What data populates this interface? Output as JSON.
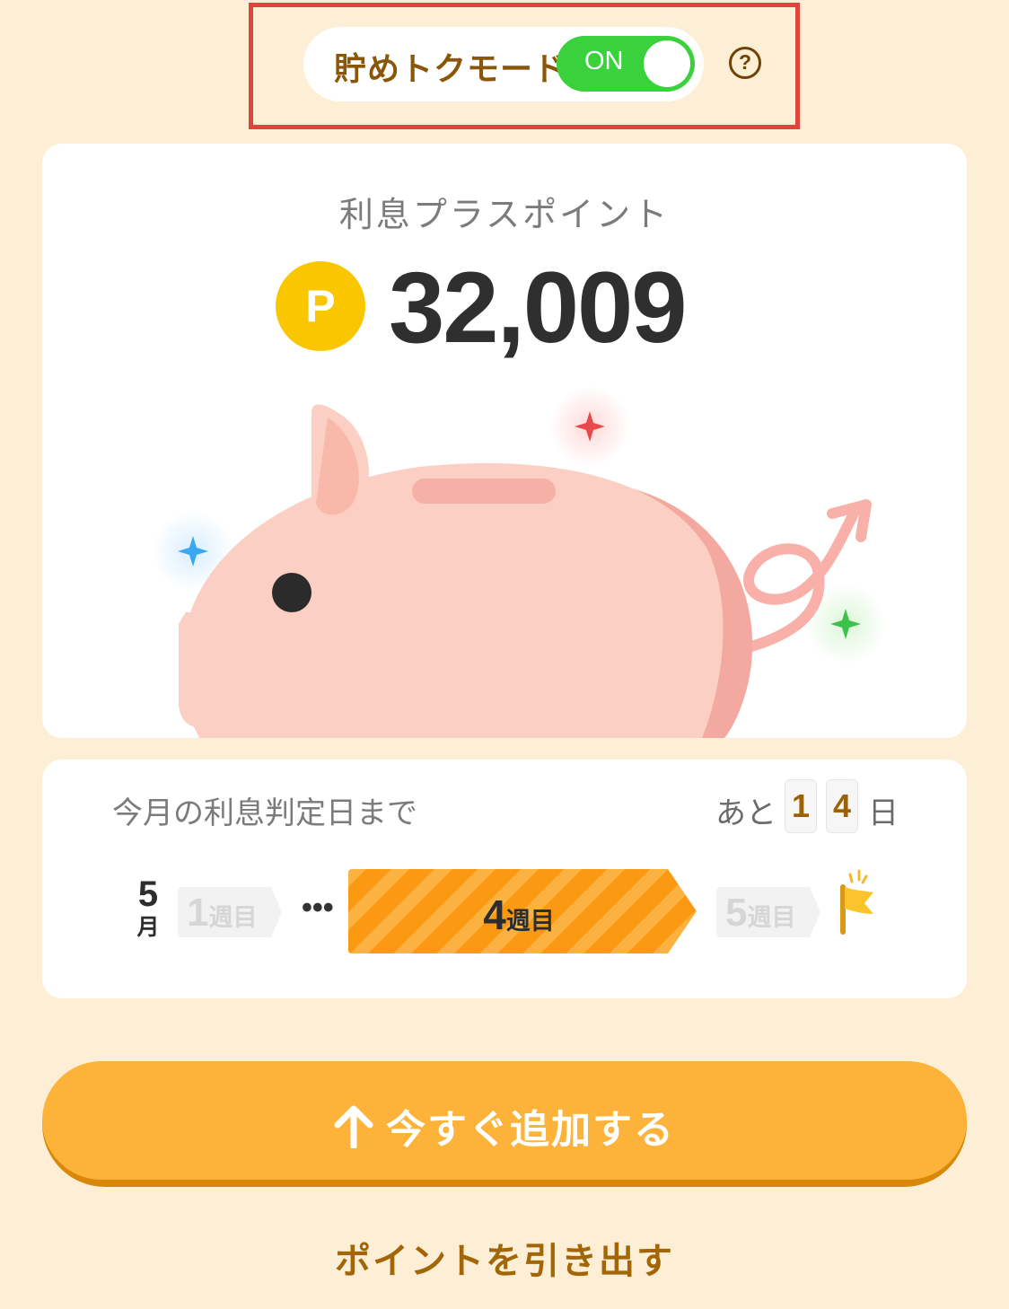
{
  "mode": {
    "label": "貯めトクモード",
    "toggle_state": "ON",
    "help_symbol": "?"
  },
  "points": {
    "title": "利息プラスポイント",
    "badge": "P",
    "value": "32,009"
  },
  "countdown": {
    "label": "今月の利息判定日まで",
    "prefix": "あと",
    "digits": [
      "1",
      "4"
    ],
    "suffix": "日",
    "month_number": "5",
    "month_unit": "月",
    "weeks": [
      {
        "number": "1",
        "unit": "週目",
        "state": "past"
      },
      {
        "number": "4",
        "unit": "週目",
        "state": "current"
      },
      {
        "number": "5",
        "unit": "週目",
        "state": "future"
      }
    ],
    "ellipsis": "•••"
  },
  "actions": {
    "add_label": "今すぐ追加する",
    "withdraw_label": "ポイントを引き出す"
  },
  "colors": {
    "background": "#fdeed6",
    "accent": "#fdb33a",
    "toggle_on": "#39d23c",
    "brown_text": "#8a5607",
    "highlight_border": "#e2443b"
  },
  "icons": [
    "help-icon",
    "point-coin-icon",
    "piggy-bank-illustration",
    "sparkle-icon",
    "goal-flag-icon",
    "arrow-up-icon"
  ]
}
